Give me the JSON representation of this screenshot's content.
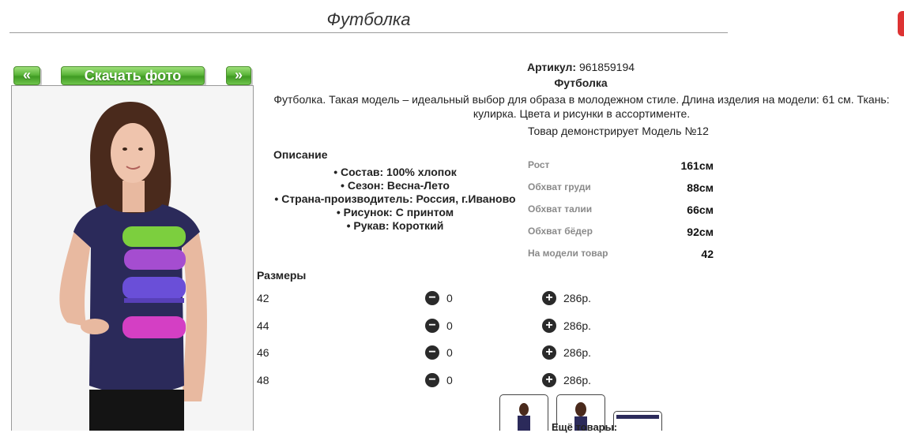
{
  "product": {
    "title": "Футболка",
    "article_label": "Артикул:",
    "article_value": "961859194",
    "name": "Футболка",
    "description": "Футболка. Такая модель – идеальный выбор для образа в молодежном стиле. Длина изделия на модели: 61 см. Ткань: кулирка. Цвета и рисунки в ассортименте.",
    "model_demo": "Товар демонстрирует Модель №12"
  },
  "buttons": {
    "prev": "«",
    "download": "Скачать фото",
    "next": "»"
  },
  "details": {
    "heading": "Описание",
    "features": [
      "Состав: 100% хлопок",
      "Сезон: Весна-Лето",
      "Страна-производитель: Россия, г.Иваново",
      "Рисунок: С принтом",
      "Рукав: Короткий"
    ]
  },
  "measurements": [
    {
      "label": "Рост",
      "value": "161см"
    },
    {
      "label": "Обхват груди",
      "value": "88см"
    },
    {
      "label": "Обхват талии",
      "value": "66см"
    },
    {
      "label": "Обхват бёдер",
      "value": "92см"
    },
    {
      "label": "На модели товар",
      "value": "42"
    }
  ],
  "sizes": {
    "heading": "Размеры",
    "rows": [
      {
        "size": "42",
        "qty": "0",
        "price": "286р."
      },
      {
        "size": "44",
        "qty": "0",
        "price": "286р."
      },
      {
        "size": "46",
        "qty": "0",
        "price": "286р."
      },
      {
        "size": "48",
        "qty": "0",
        "price": "286р."
      }
    ],
    "minus_icon": "minus-circle-icon",
    "plus_icon": "plus-circle-icon"
  },
  "more_goods": "Ещё товары:",
  "colors": {
    "button_green": "#5bb53a",
    "shirt_navy": "#2b2a5a",
    "accent_red": "#d33333"
  }
}
